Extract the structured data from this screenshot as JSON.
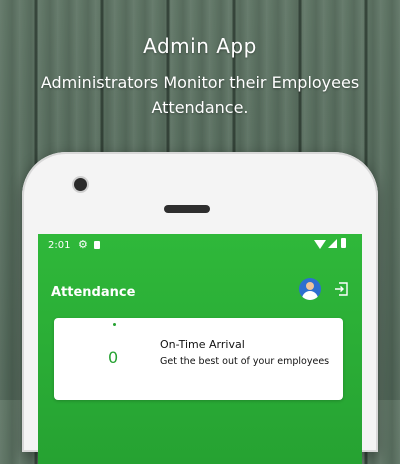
{
  "promo": {
    "title": "Admin App",
    "tagline": "Administrators Monitor their Employees Attendance."
  },
  "status_bar": {
    "time": "2:01",
    "icons": [
      "gear-icon",
      "sd-card-icon",
      "wifi-icon",
      "signal-icon",
      "battery-icon"
    ]
  },
  "app_bar": {
    "title": "Attendance",
    "actions": [
      "avatar",
      "logout-icon"
    ]
  },
  "cards": [
    {
      "count": "0",
      "title": "On-Time Arrival",
      "description": "Get the best out of your employees"
    }
  ],
  "colors": {
    "primary": "#26a232",
    "background": "#556a5c",
    "card": "#ffffff"
  }
}
